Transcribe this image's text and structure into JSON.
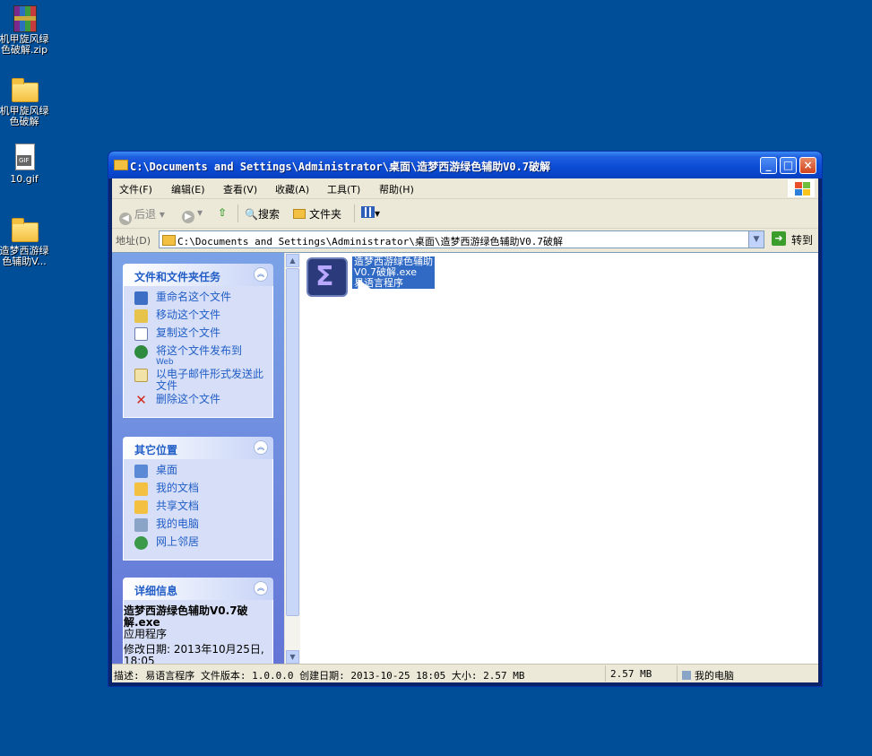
{
  "desktop": {
    "icons": [
      {
        "name": "zip-file",
        "caption": "机甲旋风绿色破解.zip",
        "display_caption": "机甲旋风绿\n色破解.zip"
      },
      {
        "name": "folder",
        "caption": "机甲旋风绿色破解",
        "display_caption": "机甲旋风绿\n色破解"
      },
      {
        "name": "gif-file",
        "caption": "10.gif",
        "display_caption": "10.gif"
      },
      {
        "name": "folder",
        "caption": "造梦西游绿色辅助V...",
        "display_caption": "造梦西游绿\n色辅助V..."
      }
    ]
  },
  "window": {
    "title": "C:\\Documents and Settings\\Administrator\\桌面\\造梦西游绿色辅助V0.7破解",
    "buttons": {
      "minimize": "_",
      "maximize": "□",
      "close": "×"
    },
    "menu": [
      "文件(F)",
      "编辑(E)",
      "查看(V)",
      "收藏(A)",
      "工具(T)",
      "帮助(H)"
    ],
    "toolbar": {
      "back": "后退",
      "search": "搜索",
      "folders": "文件夹"
    },
    "address": {
      "label": "地址(D)",
      "value": "C:\\Documents and Settings\\Administrator\\桌面\\造梦西游绿色辅助V0.7破解",
      "go": "转到"
    }
  },
  "taskpane": {
    "file_tasks": {
      "title": "文件和文件夹任务",
      "items": [
        "重命名这个文件",
        "移动这个文件",
        "复制这个文件",
        "将这个文件发布到",
        "以电子邮件形式发送此文件",
        "删除这个文件"
      ],
      "publish_sub": "Web"
    },
    "other_places": {
      "title": "其它位置",
      "items": [
        "桌面",
        "我的文档",
        "共享文档",
        "我的电脑",
        "网上邻居"
      ]
    },
    "details": {
      "title": "详细信息",
      "name": "造梦西游绿色辅助V0.7破解.exe",
      "type": "应用程序",
      "modified": "修改日期: 2013年10月25日, 18:05"
    }
  },
  "file": {
    "name_line1": "造梦西游绿色辅助",
    "name_line2": "V0.7破解.exe",
    "type": "易语言程序"
  },
  "status": {
    "description": "描述: 易语言程序 文件版本: 1.0.0.0 创建日期: 2013-10-25 18:05 大小: 2.57 MB",
    "size": "2.57 MB",
    "zone": "我的电脑"
  },
  "colors": {
    "desktop": "#004e98",
    "titlebar": "#0a4bd4",
    "selection": "#316ac5",
    "link": "#215dc6"
  }
}
